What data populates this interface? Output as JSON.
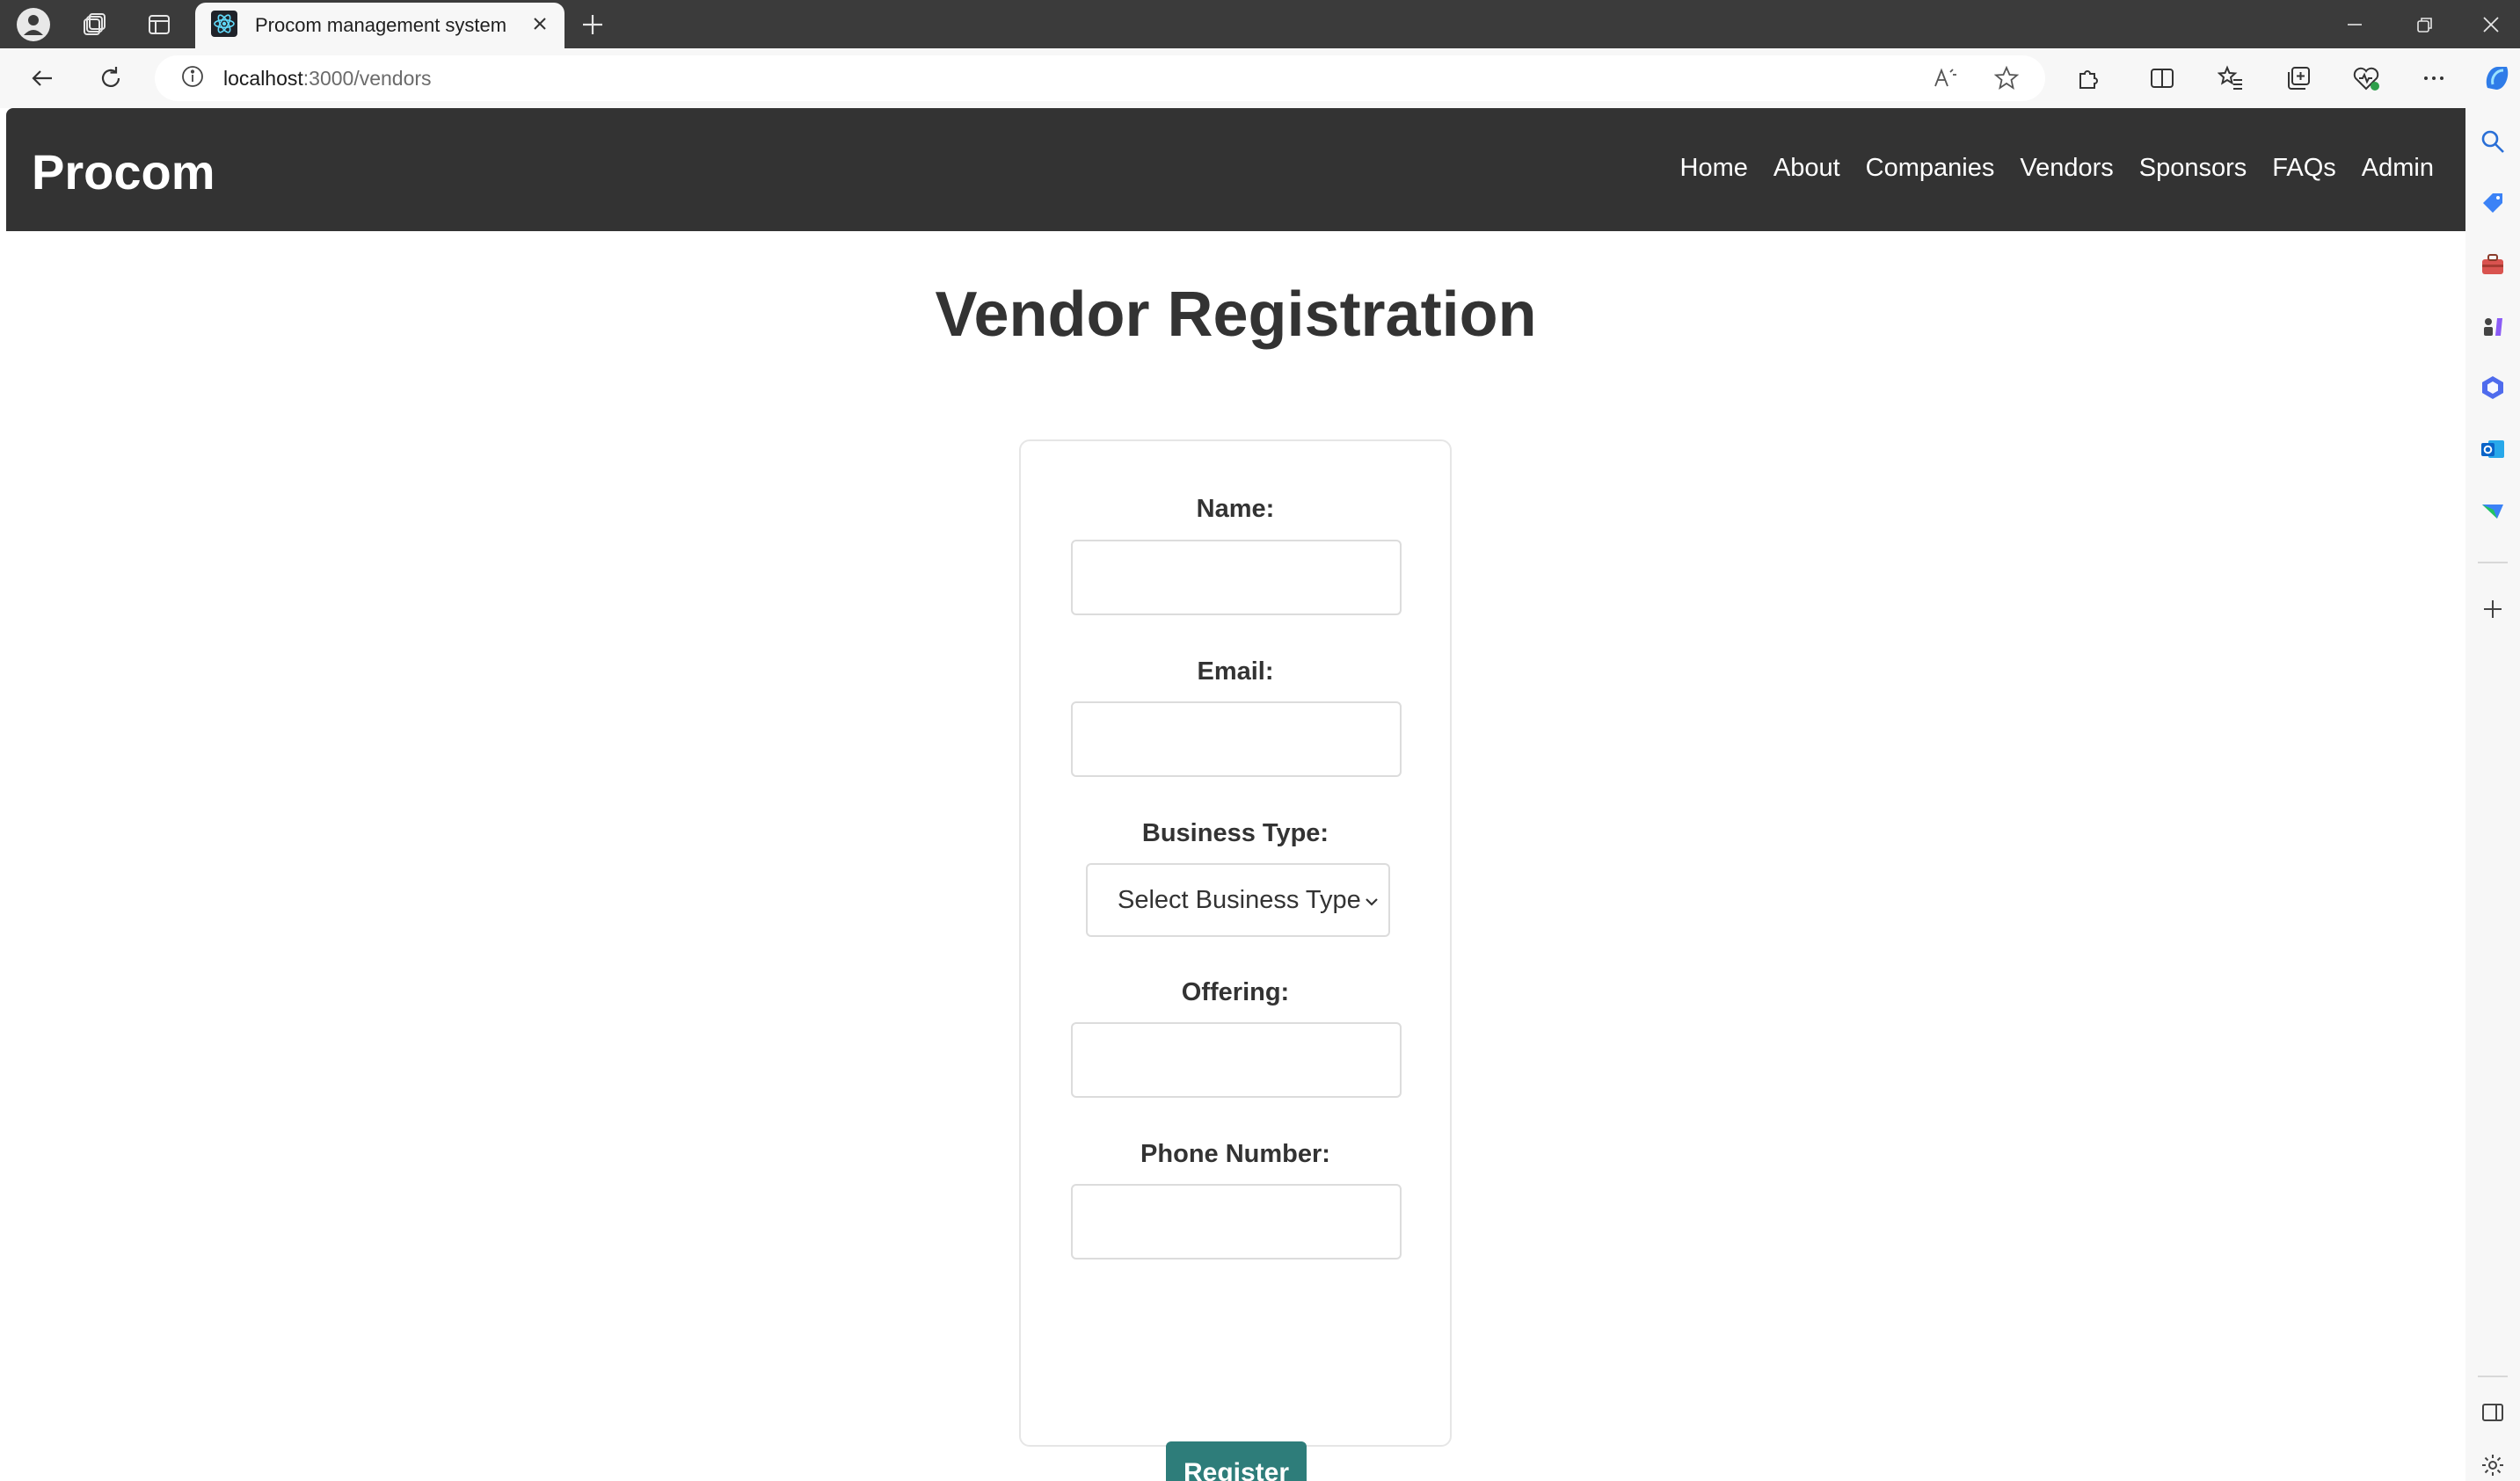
{
  "browser": {
    "tab_title": "Procom management system",
    "url_host": "localhost",
    "url_path": ":3000/vendors"
  },
  "navbar": {
    "brand": "Procom",
    "links": [
      "Home",
      "About",
      "Companies",
      "Vendors",
      "Sponsors",
      "FAQs",
      "Admin"
    ]
  },
  "page": {
    "title": "Vendor Registration"
  },
  "form": {
    "name_label": "Name:",
    "name_value": "",
    "email_label": "Email:",
    "email_value": "",
    "business_type_label": "Business Type:",
    "business_type_selected": "Select Business Type",
    "offering_label": "Offering:",
    "offering_value": "",
    "phone_label": "Phone Number:",
    "phone_value": "",
    "submit_label": "Register"
  },
  "colors": {
    "navbar_bg": "#333333",
    "button_bg": "#2e7d7a",
    "tabstrip_bg": "#3b3b3b"
  }
}
